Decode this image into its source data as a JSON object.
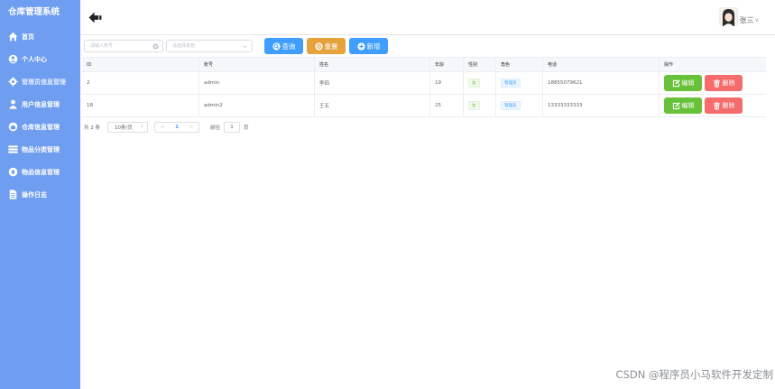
{
  "app": {
    "title": "仓库管理系统"
  },
  "sidebar": {
    "items": [
      {
        "label": "首页",
        "icon": "home-icon"
      },
      {
        "label": "个人中心",
        "icon": "user-center-icon"
      },
      {
        "label": "管理员信息管理",
        "icon": "gear-icon"
      },
      {
        "label": "用户信息管理",
        "icon": "person-icon"
      },
      {
        "label": "仓库信息管理",
        "icon": "warehouse-icon"
      },
      {
        "label": "物品分类管理",
        "icon": "list-icon"
      },
      {
        "label": "物品信息管理",
        "icon": "item-icon"
      },
      {
        "label": "操作日志",
        "icon": "document-icon"
      }
    ]
  },
  "header": {
    "username": "张三",
    "caret": "∨"
  },
  "search": {
    "name_placeholder": "请输入账号",
    "role_placeholder": "请选择角色",
    "query_label": "查询",
    "reset_label": "重置",
    "add_label": "新增"
  },
  "table": {
    "columns": [
      "ID",
      "账号",
      "姓名",
      "年龄",
      "性别",
      "角色",
      "电话",
      "操作"
    ],
    "rows": [
      {
        "id": "2",
        "account": "admin",
        "name": "李四",
        "age": "19",
        "sex": "女",
        "role": "管理员",
        "phone": "18855079621"
      },
      {
        "id": "18",
        "account": "admin2",
        "name": "王五",
        "age": "25",
        "sex": "女",
        "role": "管理员",
        "phone": "13333333333"
      }
    ],
    "edit_label": "编辑",
    "delete_label": "删除"
  },
  "pagination": {
    "total": "共 2 条",
    "page_size": "10条/页",
    "current_page": "1",
    "prev": "<",
    "next": ">",
    "goto_prefix": "前往",
    "goto_value": "1",
    "goto_suffix": "页"
  },
  "watermark": "CSDN @程序员小马软件开发定制",
  "colors": {
    "sidebar": "#6f9ef0",
    "primary": "#409eff",
    "warning": "#e6a23c",
    "success": "#67c23a",
    "danger": "#f56c6c"
  }
}
